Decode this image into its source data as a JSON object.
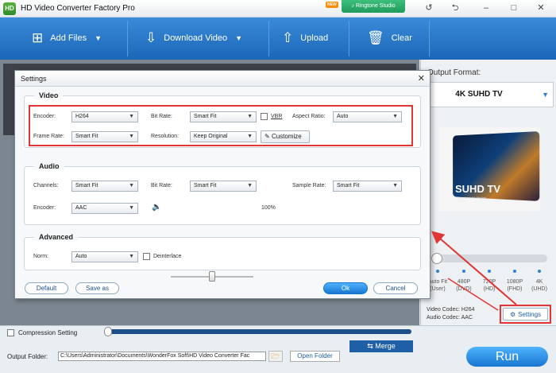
{
  "app": {
    "title": "HD Video Converter Factory Pro",
    "new_badge": "NEW",
    "ringtone": "Ringtone Studio",
    "logo": "HD"
  },
  "toolbar": {
    "add_files": "Add Files",
    "download_video": "Download Video",
    "upload": "Upload",
    "clear": "Clear"
  },
  "right": {
    "output_format_label": "Output Format:",
    "format": "4K SUHD TV",
    "tv_brand": "SUHD TV",
    "tv_sub": "Quantum dot display",
    "resolutions": [
      {
        "top": "Auto Fit",
        "bottom": "(User)"
      },
      {
        "top": "480P",
        "bottom": "(DVD)"
      },
      {
        "top": "720P",
        "bottom": "(HD)"
      },
      {
        "top": "1080P",
        "bottom": "(FHD)"
      },
      {
        "top": "4K",
        "bottom": "(UHD)"
      }
    ],
    "video_codec": "Video Codec: H264",
    "audio_codec": "Audio Codec: AAC",
    "settings_btn": "Settings"
  },
  "dialog": {
    "title": "Settings",
    "close": "✕",
    "video": {
      "title": "Video",
      "encoder_label": "Encoder:",
      "encoder": "H264",
      "bitrate_label": "Bit Rate:",
      "bitrate": "Smart Fit",
      "vbr": "VBR",
      "aspect_label": "Aspect Ratio:",
      "aspect": "Auto",
      "framerate_label": "Frame Rate:",
      "framerate": "Smart Fit",
      "resolution_label": "Resolution:",
      "resolution": "Keep Original",
      "customize": "Customize"
    },
    "audio": {
      "title": "Audio",
      "channels_label": "Channels:",
      "channels": "Smart Fit",
      "bitrate_label": "Bit Rate:",
      "bitrate": "Smart Fit",
      "samplerate_label": "Sample Rate:",
      "samplerate": "Smart Fit",
      "encoder_label": "Encoder:",
      "encoder": "AAC",
      "volume": "100%",
      "volume_level": 0.5
    },
    "advanced": {
      "title": "Advanced",
      "norm_label": "Norm:",
      "norm": "Auto",
      "deinterlace": "Deinterlace"
    },
    "buttons": {
      "default": "Default",
      "save_as": "Save as",
      "ok": "Ok",
      "cancel": "Cancel"
    }
  },
  "bottom": {
    "compression": "Compression Setting",
    "merge": "Merge",
    "output_folder_label": "Output Folder:",
    "path": "C:\\Users\\Administrator\\Documents\\WonderFox Soft\\HD Video Converter Fac",
    "open_folder": "Open Folder",
    "run": "Run"
  },
  "icons": {
    "caret": "▼",
    "folder": "🗁"
  },
  "colors": {
    "accent": "#1f6fc5",
    "highlight": "#e23535"
  }
}
